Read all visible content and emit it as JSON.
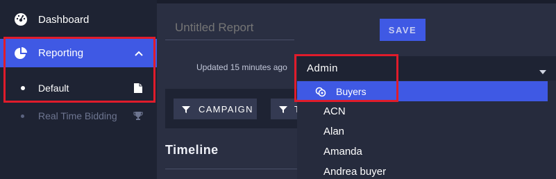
{
  "sidebar": {
    "dashboard": {
      "label": "Dashboard",
      "icon": "gauge-icon"
    },
    "reporting": {
      "label": "Reporting",
      "icon": "pie-chart-icon",
      "expanded": true
    },
    "subitems": [
      {
        "label": "Default",
        "icon": "document-icon",
        "active": true
      },
      {
        "label": "Real Time Bidding",
        "icon": "trophy-icon",
        "active": false
      }
    ]
  },
  "report": {
    "title_placeholder": "Untitled Report",
    "save_label": "SAVE",
    "updated_text": "Updated 15 minutes ago"
  },
  "user_select": {
    "value": "Admin",
    "options": [
      "Buyers",
      "ACN",
      "Alan",
      "Amanda",
      "Andrea buyer"
    ],
    "highlighted": "Buyers"
  },
  "filters": {
    "campaign_label": "CAMPAIGN",
    "second_label": "T"
  },
  "timeline": {
    "title": "Timeline"
  },
  "colors": {
    "accent": "#3f59e4",
    "sidebar_bg": "#1e2333",
    "main_bg": "#2a2f42",
    "annotation_red": "#e01c2b"
  }
}
